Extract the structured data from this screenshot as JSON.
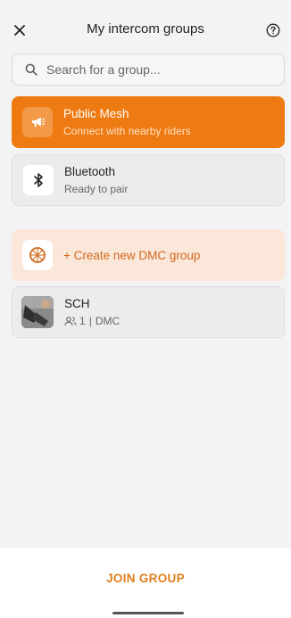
{
  "header": {
    "title": "My intercom groups",
    "close_icon": "close-icon",
    "help_icon": "help-circle-icon"
  },
  "search": {
    "placeholder": "Search for a group...",
    "value": ""
  },
  "groups": [
    {
      "title": "Public Mesh",
      "subtitle": "Connect with nearby riders",
      "icon": "megaphone-icon"
    },
    {
      "title": "Bluetooth",
      "subtitle": "Ready to pair",
      "icon": "bluetooth-icon"
    }
  ],
  "create": {
    "label": "+ Create new DMC group",
    "icon": "globe-mesh-icon"
  },
  "my_groups": [
    {
      "name": "SCH",
      "members": "1",
      "separator": "|",
      "type": "DMC",
      "members_icon": "people-icon"
    }
  ],
  "footer": {
    "join_label": "JOIN GROUP"
  },
  "colors": {
    "accent": "#ee7a12",
    "accent_light": "#fbe6da",
    "join": "#e07f1e"
  }
}
